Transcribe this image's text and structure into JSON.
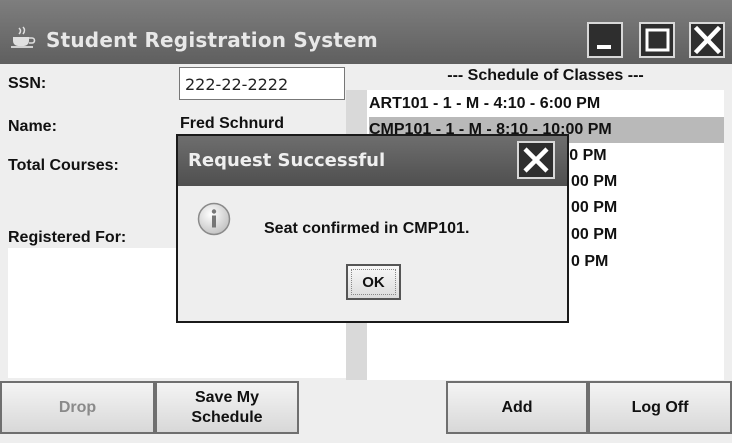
{
  "window": {
    "title": "Student Registration System"
  },
  "form": {
    "ssn_label": "SSN:",
    "ssn_value": "222-22-2222",
    "name_label": "Name:",
    "name_value": "Fred Schnurd",
    "total_courses_label": "Total Courses:",
    "registered_for_label": "Registered For:"
  },
  "schedule": {
    "header": "--- Schedule of Classes ---",
    "items": [
      {
        "text": "ART101 - 1 - M - 4:10 - 6:00 PM",
        "selected": false
      },
      {
        "text": "CMP101 - 1 - M - 8:10 - 10:00 PM",
        "selected": true
      },
      {
        "text": ":00 PM",
        "selected": false
      },
      {
        "text": "00 PM",
        "selected": false
      },
      {
        "text": "00 PM",
        "selected": false
      },
      {
        "text": "00 PM",
        "selected": false
      },
      {
        "text": "0 PM",
        "selected": false
      }
    ]
  },
  "buttons": {
    "drop": "Drop",
    "save_line1": "Save My",
    "save_line2": "Schedule",
    "add": "Add",
    "logoff": "Log Off"
  },
  "dialog": {
    "title": "Request Successful",
    "message": "Seat confirmed in CMP101.",
    "ok": "OK",
    "icon": "info-icon"
  }
}
